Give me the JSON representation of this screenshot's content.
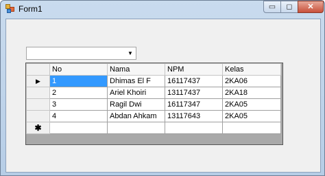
{
  "window": {
    "title": "Form1",
    "controls": {
      "minimize": "▭",
      "maximize": "◻",
      "close": "✕"
    }
  },
  "combobox": {
    "value": ""
  },
  "grid": {
    "columns": [
      "No",
      "Nama",
      "NPM",
      "Kelas"
    ],
    "rows": [
      {
        "indicator": "▶",
        "no": "1",
        "nama": "Dhimas El F",
        "npm": "16117437",
        "kelas": "2KA06"
      },
      {
        "indicator": "",
        "no": "2",
        "nama": "Ariel Khoiri",
        "npm": "13117437",
        "kelas": "2KA18"
      },
      {
        "indicator": "",
        "no": "3",
        "nama": "Ragil Dwi",
        "npm": "16117347",
        "kelas": "2KA05"
      },
      {
        "indicator": "",
        "no": "4",
        "nama": "Abdan Ahkam",
        "npm": "13117643",
        "kelas": "2KA05"
      }
    ],
    "new_row_indicator": "✱",
    "colors": {
      "selected_bg": "#3399ff",
      "grid_bg": "#a9a9a9"
    }
  }
}
